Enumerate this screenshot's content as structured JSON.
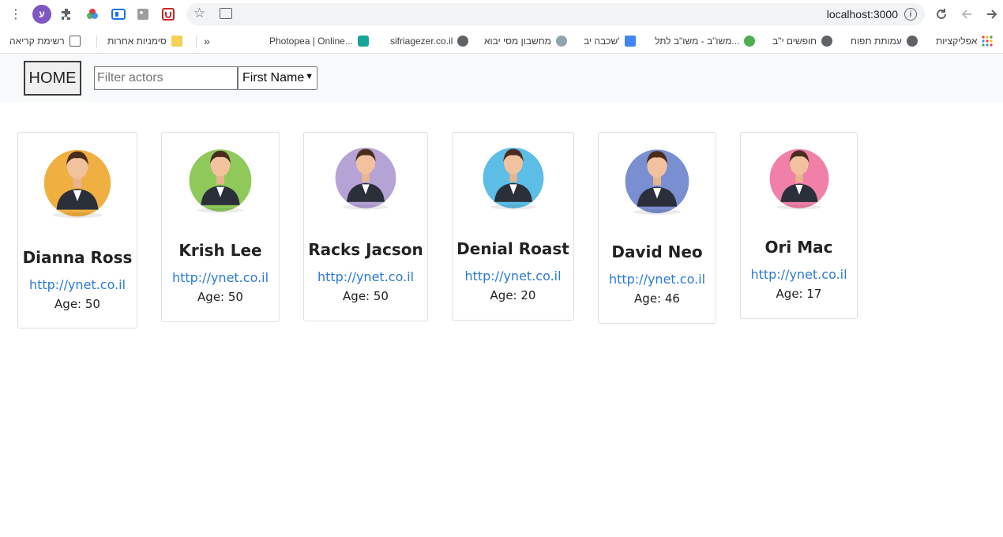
{
  "browser": {
    "url": "localhost:3000",
    "profile_letter": "ע",
    "bookmarks": [
      {
        "label": "אפליקציות"
      },
      {
        "label": "עמותת תפוח"
      },
      {
        "label": "חופשים י\"ב"
      },
      {
        "label": "משו\"ב - משו\"ב לתל..."
      },
      {
        "label": "שכבה יב'"
      },
      {
        "label": "מחשבון מסי יבוא"
      },
      {
        "label": "sifriagezer.co.il"
      },
      {
        "label": "Photopea | Online..."
      },
      {
        "label": "»"
      },
      {
        "label": "סימניות אחרות"
      },
      {
        "label": "רשימת קריאה"
      }
    ]
  },
  "nav": {
    "home_label": "HOME",
    "filter_placeholder": "Filter actors",
    "sort_value": "First Name"
  },
  "actors": [
    {
      "name": "Dianna Ross",
      "link": "http://ynet.co.il",
      "age": "Age: 50",
      "bg": "#f0b041"
    },
    {
      "name": "Krish Lee",
      "link": "http://ynet.co.il",
      "age": "Age: 50",
      "bg": "#8ec95a"
    },
    {
      "name": "Racks Jacson",
      "link": "http://ynet.co.il",
      "age": "Age: 50",
      "bg": "#b6a3d6"
    },
    {
      "name": "Denial Roast",
      "link": "http://ynet.co.il",
      "age": "Age: 20",
      "bg": "#5cbde6"
    },
    {
      "name": "David Neo",
      "link": "http://ynet.co.il",
      "age": "Age: 46",
      "bg": "#7a8fd1"
    },
    {
      "name": "Ori Mac",
      "link": "http://ynet.co.il",
      "age": "Age: 17",
      "bg": "#f080a8"
    }
  ]
}
